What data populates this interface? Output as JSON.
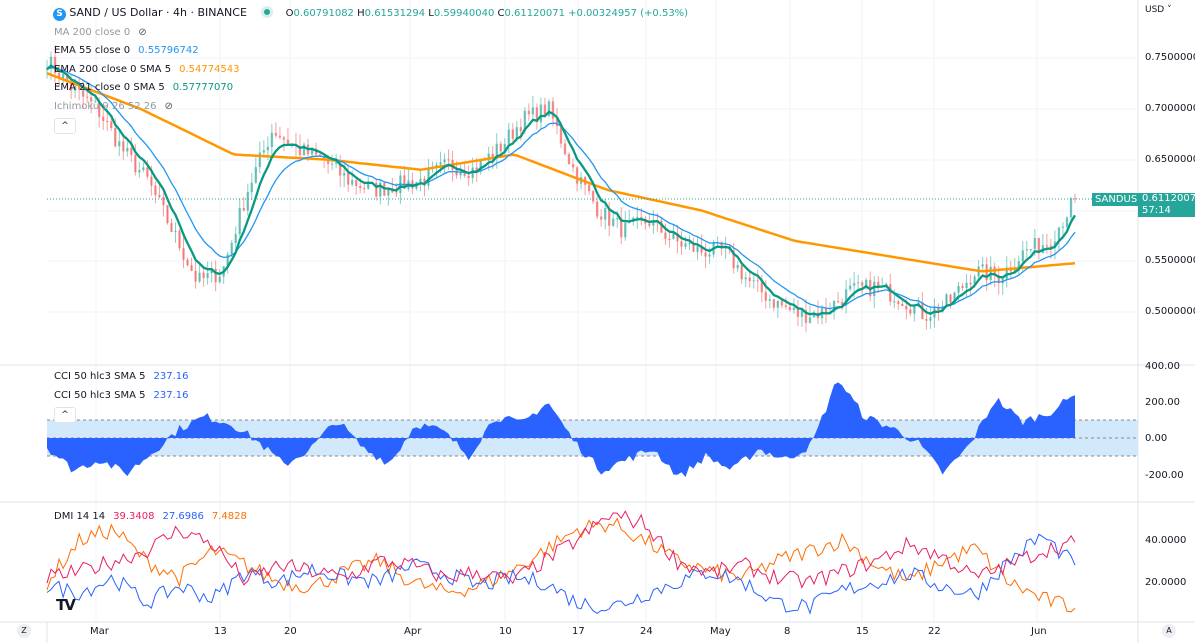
{
  "header": {
    "symbol_icon": "S",
    "title": "SAND / US Dollar · 4h · BINANCE",
    "status_dot_color": "#26a69a",
    "ohlc": {
      "o_label": "O",
      "o": "0.60791082",
      "h_label": "H",
      "h": "0.61531294",
      "l_label": "L",
      "l": "0.59940040",
      "c_label": "C",
      "c": "0.61120071",
      "change": "+0.00324957 (+0.53%)"
    }
  },
  "indicators": [
    {
      "label": "MA 200 close 0",
      "value": "",
      "color": "#9598a1",
      "hidden": true
    },
    {
      "label": "EMA 55 close 0",
      "value": "0.55796742",
      "color": "#2196f3"
    },
    {
      "label": "EMA 200 close 0 SMA 5",
      "value": "0.54774543",
      "color": "#ff9800"
    },
    {
      "label": "EMA 21 close 0 SMA 5",
      "value": "0.57777070",
      "color": "#089981"
    },
    {
      "label": "Ichimoku 9 26 52 26",
      "value": "",
      "color": "#9598a1",
      "hidden": true
    }
  ],
  "price_axis": {
    "currency": "USD",
    "ticks": [
      "0.75000000",
      "0.70000000",
      "0.65000000",
      "0.55000000",
      "0.50000000"
    ],
    "last_label": "SANDUSD",
    "last_price": "0.61120071",
    "countdown": "57:14",
    "accent": "#26a69a"
  },
  "cci": {
    "legend": [
      {
        "label": "CCI 50 hlc3 SMA 5",
        "value": "237.16"
      },
      {
        "label": "CCI 50 hlc3 SMA 5",
        "value": "237.16"
      }
    ],
    "ticks": [
      "400.00",
      "200.00",
      "0.00",
      "-200.00"
    ],
    "color": "#2962ff",
    "band": [
      -100,
      100
    ]
  },
  "dmi": {
    "label": "DMI 14 14",
    "plus": "39.3408",
    "minus": "27.6986",
    "adx": "7.4828",
    "colors": [
      "#e91e63",
      "#2962ff",
      "#ff6d00"
    ],
    "ticks": [
      "40.0000",
      "20.0000"
    ]
  },
  "time_axis": {
    "labels": [
      "Mar",
      "13",
      "20",
      "Apr",
      "10",
      "17",
      "24",
      "May",
      "8",
      "15",
      "22",
      "Jun"
    ],
    "left_button": "Z",
    "right_button": "A"
  },
  "chart_data": {
    "type": "line",
    "title": "SAND / US Dollar · 4h · BINANCE",
    "price_close_keypoints": [
      0.748,
      0.72,
      0.7,
      0.66,
      0.63,
      0.58,
      0.53,
      0.54,
      0.62,
      0.68,
      0.66,
      0.65,
      0.63,
      0.62,
      0.625,
      0.63,
      0.645,
      0.64,
      0.66,
      0.69,
      0.7,
      0.64,
      0.6,
      0.58,
      0.59,
      0.57,
      0.56,
      0.56,
      0.53,
      0.51,
      0.497,
      0.5,
      0.52,
      0.525,
      0.515,
      0.497,
      0.51,
      0.54,
      0.535,
      0.56,
      0.57,
      0.611
    ],
    "ema200_keypoints": [
      0.735,
      0.7,
      0.655,
      0.65,
      0.64,
      0.655,
      0.62,
      0.6,
      0.57,
      0.555,
      0.54,
      0.548
    ],
    "cci_keypoints": [
      -50,
      -180,
      -120,
      -200,
      -80,
      50,
      120,
      80,
      -20,
      -150,
      -60,
      100,
      -60,
      -140,
      80,
      40,
      -100,
      120,
      80,
      200,
      -20,
      -180,
      -120,
      -60,
      -220,
      -100,
      -180,
      -60,
      -120,
      -40,
      330,
      120,
      60,
      -20,
      -200,
      -40,
      220,
      90,
      140,
      237
    ],
    "dmi_plus_keypoints": [
      22,
      25,
      30,
      35,
      45,
      38,
      20,
      28,
      25,
      22,
      30,
      28,
      22,
      25,
      20,
      30,
      40,
      52,
      48,
      30,
      24,
      28,
      22,
      20,
      25,
      30,
      38,
      32,
      22,
      28,
      35,
      39
    ],
    "dmi_minus_keypoints": [
      18,
      15,
      22,
      10,
      18,
      12,
      25,
      20,
      26,
      22,
      20,
      28,
      24,
      18,
      22,
      20,
      10,
      8,
      14,
      20,
      25,
      20,
      10,
      8,
      16,
      20,
      24,
      18,
      14,
      30,
      42,
      28
    ],
    "adx_keypoints": [
      20,
      40,
      45,
      30,
      22,
      35,
      28,
      20,
      18,
      25,
      30,
      20,
      15,
      18,
      25,
      35,
      45,
      48,
      40,
      30,
      25,
      22,
      30,
      35,
      40,
      28,
      20,
      30,
      36,
      20,
      12,
      7.5
    ],
    "price_range": [
      0.46,
      0.78
    ],
    "cci_range": [
      -300,
      400
    ],
    "dmi_range": [
      0,
      60
    ]
  }
}
